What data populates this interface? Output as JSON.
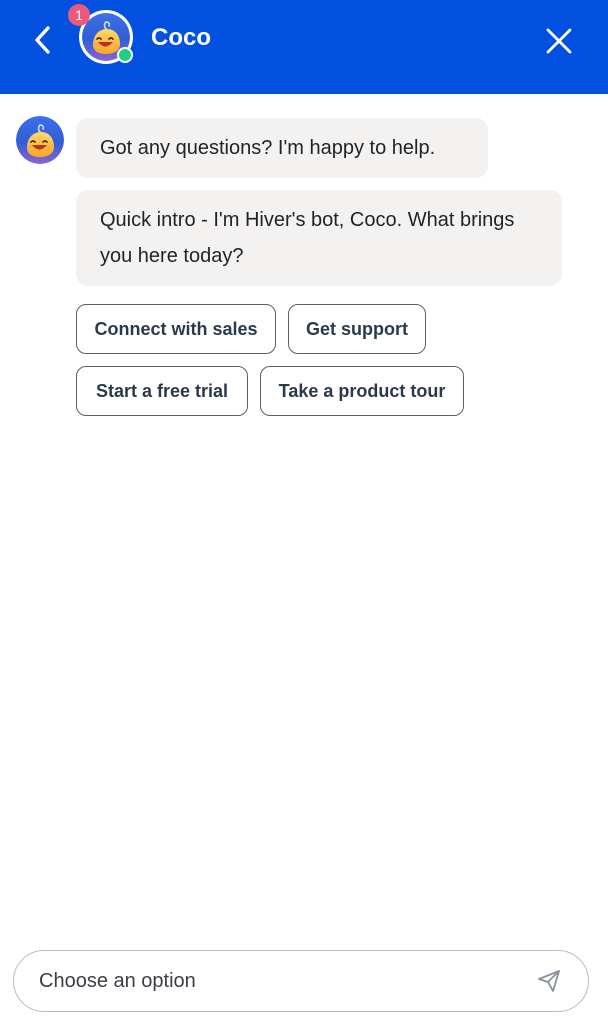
{
  "header": {
    "title": "Coco",
    "notification_count": "1",
    "status": "online",
    "background_color": "#0250e0",
    "back_icon": "chevron-left-icon",
    "close_icon": "close-icon"
  },
  "messages": [
    {
      "sender": "bot",
      "text": "Got any questions? I'm happy to help."
    },
    {
      "sender": "bot",
      "text": "Quick intro - I'm Hiver's bot, Coco. What brings you here today?"
    }
  ],
  "quick_replies": [
    {
      "label": "Connect with sales"
    },
    {
      "label": "Get support"
    },
    {
      "label": "Start a free trial"
    },
    {
      "label": "Take a product tour"
    }
  ],
  "composer": {
    "placeholder": "Choose an option",
    "send_icon": "send-icon"
  },
  "colors": {
    "accent": "#0250e0",
    "badge": "#ec5a7b",
    "online": "#1fcf86",
    "bubble_bg": "#f3f2f1",
    "chip_border": "#5a6069"
  }
}
